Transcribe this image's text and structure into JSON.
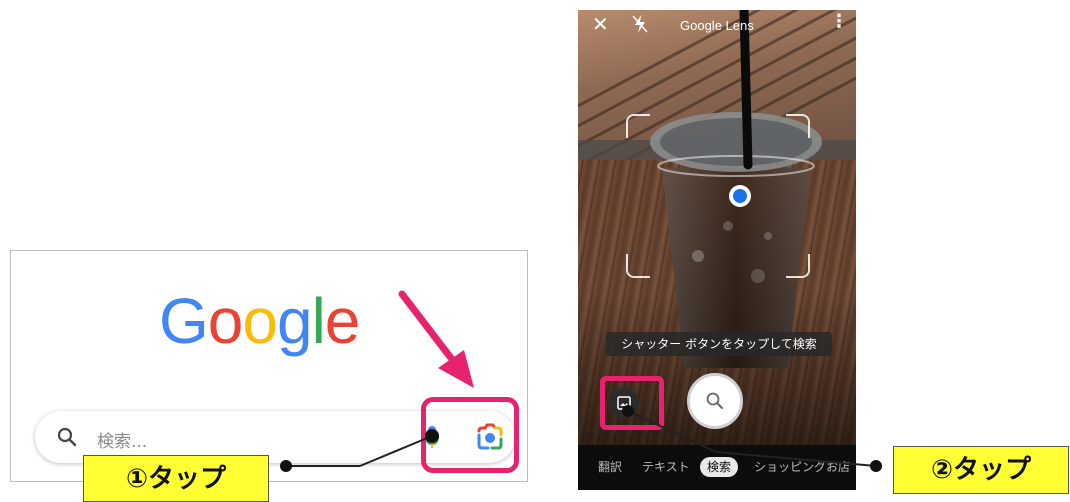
{
  "left_panel": {
    "logo": [
      "G",
      "o",
      "o",
      "g",
      "l",
      "e"
    ],
    "logo_colors": [
      "#4285f4",
      "#ea4335",
      "#fbbc05",
      "#4285f4",
      "#34a853",
      "#ea4335"
    ],
    "search_placeholder": "検索..."
  },
  "phone": {
    "title": "Google Lens",
    "tooltip": "シャッター ボタンをタップして検索",
    "tabs": [
      "翻訳",
      "テキスト",
      "検索",
      "ショッピング",
      "お店"
    ],
    "selected_tab": "検索"
  },
  "labels": {
    "step1": "①タップ",
    "step2": "②タップ"
  },
  "colors": {
    "highlight": "#e8236e",
    "label_bg": "#ffff33",
    "lens_dot": "#1a73e8"
  }
}
